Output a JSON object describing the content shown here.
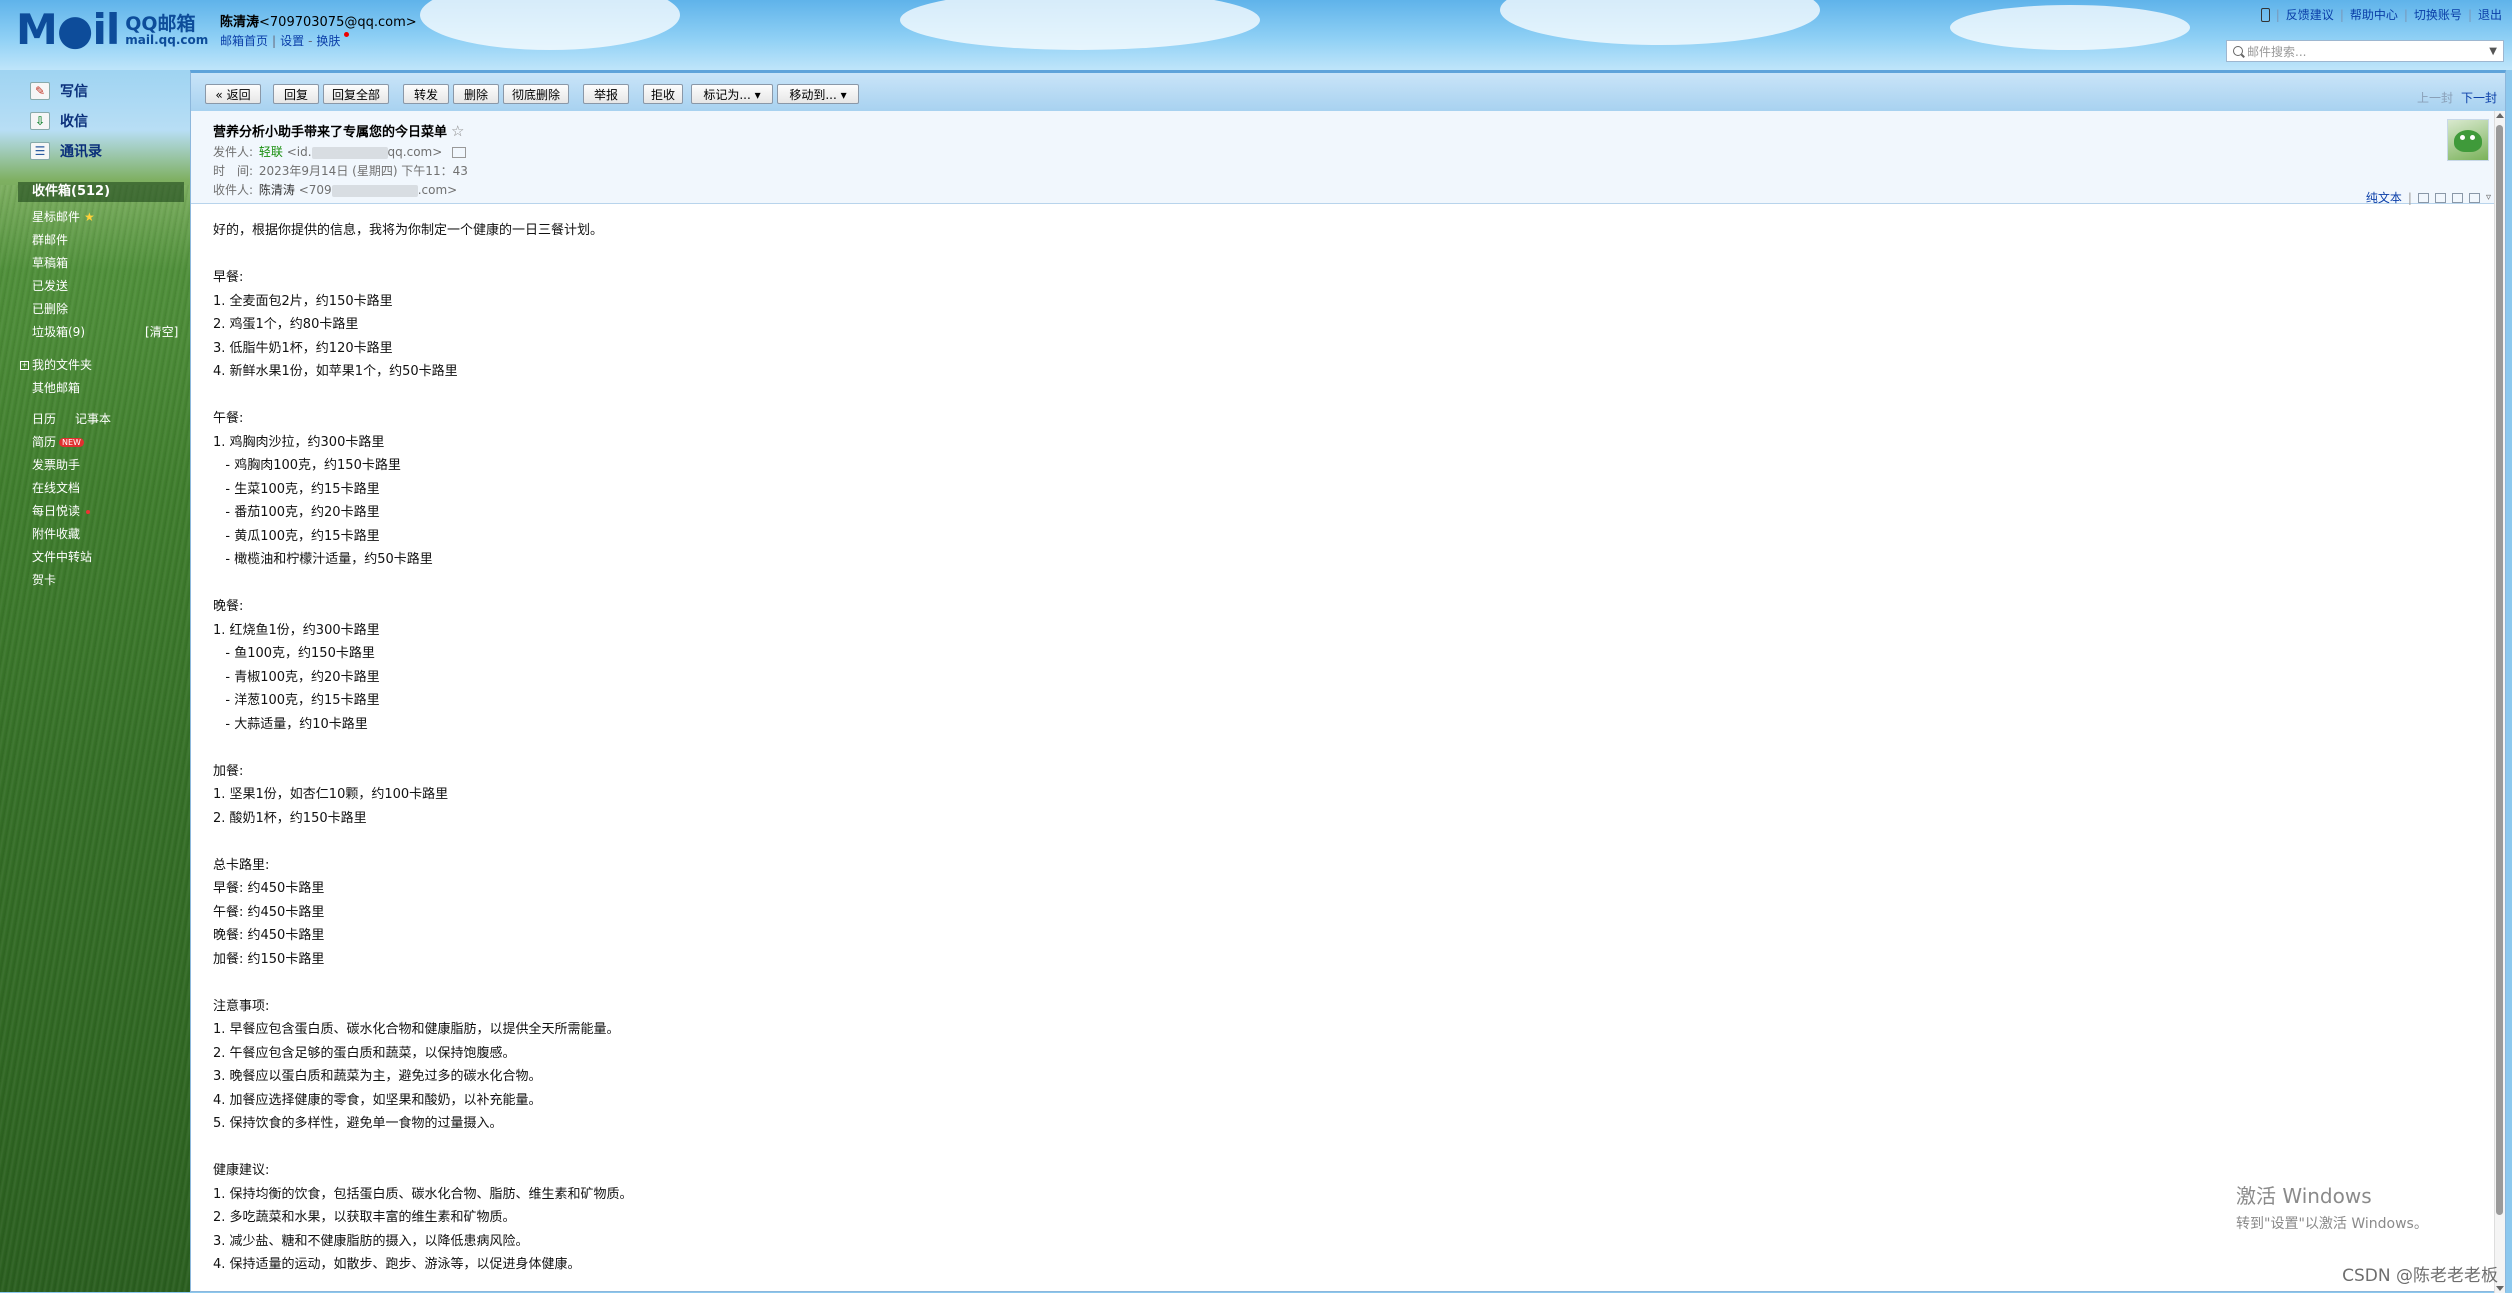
{
  "header": {
    "logo_text": "M●il",
    "brand": "QQ邮箱",
    "brand_url": "mail.qq.com",
    "user_name": "陈清涛",
    "user_email": "<709703075@qq.com>",
    "links": [
      "邮箱首页",
      "设置",
      "换肤"
    ],
    "top_links": [
      "反馈建议",
      "帮助中心",
      "切换账号",
      "退出"
    ],
    "search_placeholder": "邮件搜索..."
  },
  "sidebar": {
    "compose": "写信",
    "receive": "收信",
    "contacts": "通讯录",
    "inbox": "收件箱(512)",
    "folders": [
      "星标邮件",
      "群邮件",
      "草稿箱",
      "已发送",
      "已删除",
      "垃圾箱(9)"
    ],
    "clear": "[清空]",
    "my_folders": "我的文件夹",
    "other_mail": "其他邮箱",
    "apps": [
      "日历",
      "记事本",
      "简历",
      "发票助手",
      "在线文档",
      "每日悦读",
      "附件收藏",
      "文件中转站",
      "贺卡"
    ],
    "new_badge": "NEW"
  },
  "toolbar": {
    "back": "« 返回",
    "buttons": [
      "回复",
      "回复全部",
      "转发",
      "删除",
      "彻底删除",
      "举报",
      "拒收",
      "标记为... ▾",
      "移动到... ▾"
    ],
    "prev": "上一封",
    "next": "下一封"
  },
  "message": {
    "subject": "营养分析小助手带来了专属您的今日菜单",
    "star": "☆",
    "from_label": "发件人:",
    "from_name": "轻联",
    "from_addr_pre": "<id.",
    "from_addr_post": "qq.com>",
    "time_label": "时　间:",
    "time_value": "2023年9月14日 (星期四) 下午11：43",
    "to_label": "收件人:",
    "to_name": "陈清涛",
    "to_addr_pre": "<709",
    "to_addr_post": ".com>",
    "plain_text": "纯文本",
    "body_lines": [
      "好的，根据你提供的信息，我将为你制定一个健康的一日三餐计划。",
      "",
      "早餐:",
      "1. 全麦面包2片，约150卡路里",
      "2. 鸡蛋1个，约80卡路里",
      "3. 低脂牛奶1杯，约120卡路里",
      "4. 新鲜水果1份，如苹果1个，约50卡路里",
      "",
      "午餐:",
      "1. 鸡胸肉沙拉，约300卡路里",
      "   - 鸡胸肉100克，约150卡路里",
      "   - 生菜100克，约15卡路里",
      "   - 番茄100克，约20卡路里",
      "   - 黄瓜100克，约15卡路里",
      "   - 橄榄油和柠檬汁适量，约50卡路里",
      "",
      "晚餐:",
      "1. 红烧鱼1份，约300卡路里",
      "   - 鱼100克，约150卡路里",
      "   - 青椒100克，约20卡路里",
      "   - 洋葱100克，约15卡路里",
      "   - 大蒜适量，约10卡路里",
      "",
      "加餐:",
      "1. 坚果1份，如杏仁10颗，约100卡路里",
      "2. 酸奶1杯，约150卡路里",
      "",
      "总卡路里:",
      "早餐: 约450卡路里",
      "午餐: 约450卡路里",
      "晚餐: 约450卡路里",
      "加餐: 约150卡路里",
      "",
      "注意事项:",
      "1. 早餐应包含蛋白质、碳水化合物和健康脂肪，以提供全天所需能量。",
      "2. 午餐应包含足够的蛋白质和蔬菜，以保持饱腹感。",
      "3. 晚餐应以蛋白质和蔬菜为主，避免过多的碳水化合物。",
      "4. 加餐应选择健康的零食，如坚果和酸奶，以补充能量。",
      "5. 保持饮食的多样性，避免单一食物的过量摄入。",
      "",
      "健康建议:",
      "1. 保持均衡的饮食，包括蛋白质、碳水化合物、脂肪、维生素和矿物质。",
      "2. 多吃蔬菜和水果，以获取丰富的维生素和矿物质。",
      "3. 减少盐、糖和不健康脂肪的摄入，以降低患病风险。",
      "4. 保持适量的运动，如散步、跑步、游泳等，以促进身体健康。"
    ]
  },
  "overlay": {
    "win_title": "激活 Windows",
    "win_sub": "转到\"设置\"以激活 Windows。",
    "csdn": "CSDN @陈老老老板"
  }
}
